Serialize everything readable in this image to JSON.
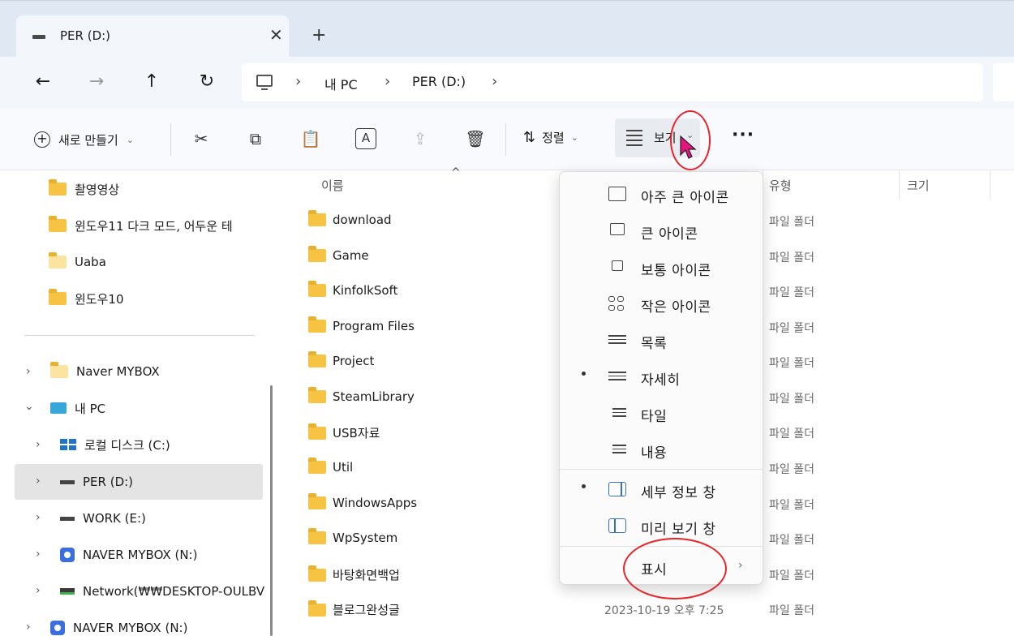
{
  "tab": {
    "title": "PER (D:)",
    "close_glyph": "✕",
    "new_glyph": "+"
  },
  "nav": {
    "back": "←",
    "forward": "→",
    "up": "↑",
    "refresh": "↻"
  },
  "address": {
    "separator": "›",
    "crumbs": [
      "내 PC",
      "PER (D:)"
    ],
    "trailing": "›"
  },
  "toolbar": {
    "new_label": "새로 만들기",
    "new_plus": "+",
    "chevron": "⌄",
    "cut": "✂",
    "copy": "⧉",
    "paste": "📋",
    "rename": "A",
    "share": "⇪",
    "delete": "🗑",
    "sort_icon": "⇅",
    "sort_label": "정렬",
    "view_label": "보기",
    "more": "···"
  },
  "sidebar": {
    "quick": [
      {
        "label": "촬영영상"
      },
      {
        "label": "윈도우11 다크 모드, 어두운 테"
      },
      {
        "label": "Uaba"
      },
      {
        "label": "윈도우10"
      }
    ],
    "tree": [
      {
        "label": "Naver MYBOX"
      },
      {
        "label": "내 PC"
      },
      {
        "label": "로컬 디스크 (C:)"
      },
      {
        "label": "PER (D:)"
      },
      {
        "label": "WORK (E:)"
      },
      {
        "label": "NAVER MYBOX (N:)"
      },
      {
        "label": "Network(₩₩DESKTOP-OULBV"
      },
      {
        "label": "NAVER MYBOX (N:)"
      }
    ],
    "expand_closed": "›",
    "expand_open": "⌄"
  },
  "columns": {
    "name": "이름",
    "type": "유형",
    "size": "크기",
    "sort_caret": "^"
  },
  "files": [
    {
      "name": "download",
      "type": "파일 폴더"
    },
    {
      "name": "Game",
      "type": "파일 폴더"
    },
    {
      "name": "KinfolkSoft",
      "type": "파일 폴더"
    },
    {
      "name": "Program Files",
      "type": "파일 폴더"
    },
    {
      "name": "Project",
      "type": "파일 폴더"
    },
    {
      "name": "SteamLibrary",
      "type": "파일 폴더"
    },
    {
      "name": "USB자료",
      "type": "파일 폴더"
    },
    {
      "name": "Util",
      "type": "파일 폴더"
    },
    {
      "name": "WindowsApps",
      "type": "파일 폴더"
    },
    {
      "name": "WpSystem",
      "type": "파일 폴더"
    },
    {
      "name": "바탕화면백업",
      "type": "파일 폴더"
    },
    {
      "name": "블로그완성글",
      "type": "파일 폴더",
      "date": "2023-10-19 오후 7:25"
    }
  ],
  "view_menu": {
    "items": [
      {
        "label": "아주 큰 아이콘"
      },
      {
        "label": "큰 아이콘"
      },
      {
        "label": "보통 아이콘"
      },
      {
        "label": "작은 아이콘"
      },
      {
        "label": "목록"
      },
      {
        "label": "자세히"
      },
      {
        "label": "타일"
      },
      {
        "label": "내용"
      },
      {
        "label": "세부 정보 창"
      },
      {
        "label": "미리 보기 창"
      },
      {
        "label": "표시"
      }
    ],
    "submenu_glyph": "›"
  },
  "colors": {
    "annotation": "#e8232a",
    "folder": "#f6c343",
    "cursor": "#e4157e"
  }
}
